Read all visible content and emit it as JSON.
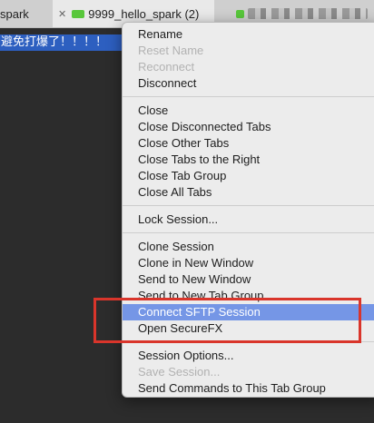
{
  "tabs": [
    {
      "label": "spark",
      "close": "✕",
      "status_color": ""
    },
    {
      "label": "9999_hello_spark (2)",
      "close": "✕",
      "status_color": "#58c73b"
    },
    {
      "label": "",
      "close": "",
      "status_color": "#58c73b"
    }
  ],
  "terminal": {
    "highlighted_text": "避免打爆了！！！！"
  },
  "menu": {
    "items": [
      {
        "label": "Rename",
        "enabled": true
      },
      {
        "label": "Reset Name",
        "enabled": false
      },
      {
        "label": "Reconnect",
        "enabled": false
      },
      {
        "label": "Disconnect",
        "enabled": true
      },
      {
        "label": "Close",
        "enabled": true
      },
      {
        "label": "Close Disconnected Tabs",
        "enabled": true
      },
      {
        "label": "Close Other Tabs",
        "enabled": true
      },
      {
        "label": "Close Tabs to the Right",
        "enabled": true
      },
      {
        "label": "Close Tab Group",
        "enabled": true
      },
      {
        "label": "Close All Tabs",
        "enabled": true
      },
      {
        "label": "Lock Session...",
        "enabled": true
      },
      {
        "label": "Clone Session",
        "enabled": true
      },
      {
        "label": "Clone in New Window",
        "enabled": true
      },
      {
        "label": "Send to New Window",
        "enabled": true
      },
      {
        "label": "Send to New Tab Group",
        "enabled": true
      },
      {
        "label": "Connect SFTP Session",
        "enabled": true,
        "highlighted": true
      },
      {
        "label": "Open SecureFX",
        "enabled": true
      },
      {
        "label": "Session Options...",
        "enabled": true
      },
      {
        "label": "Save Session...",
        "enabled": false
      },
      {
        "label": "Send Commands to This Tab Group",
        "enabled": true
      }
    ]
  },
  "colors": {
    "menu_highlight": "#7596e6",
    "annotation_red": "#d9352b",
    "terminal_selection": "#2d5fc0"
  }
}
